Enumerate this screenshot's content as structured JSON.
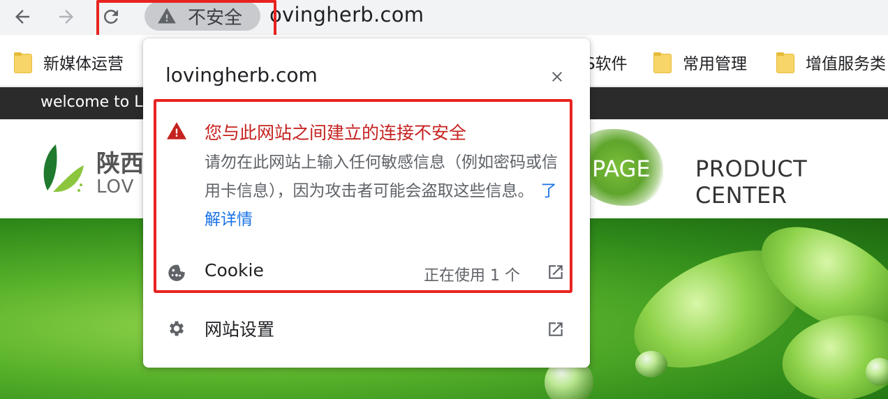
{
  "browser": {
    "back_icon": "arrow-left-icon",
    "forward_icon": "arrow-right-icon",
    "reload_icon": "reload-icon",
    "security_chip": {
      "icon": "warning-triangle-icon",
      "label": "不安全"
    },
    "url_visible": "ovingherb.com"
  },
  "bookmarks": [
    {
      "label": "新媒体运营",
      "icon": "folder-icon"
    },
    {
      "label": "S软件",
      "icon": "folder-icon"
    },
    {
      "label": "常用管理",
      "icon": "folder-icon"
    },
    {
      "label": "增值服务类",
      "icon": "folder-icon"
    }
  ],
  "site": {
    "welcome_text": "welcome to L",
    "logo_cn": "陕西",
    "logo_en": "LOV",
    "nav_home": "PAGE",
    "nav_product": "PRODUCT CENTER"
  },
  "popup": {
    "title": "lovingherb.com",
    "close_icon": "close-icon",
    "warning": {
      "icon": "warning-triangle-icon",
      "title": "您与此网站之间建立的连接不安全",
      "body": "请勿在此网站上输入任何敏感信息（例如密码或信用卡信息），因为攻击者可能会盗取这些信息。",
      "link": "了解详情"
    },
    "cookie": {
      "icon": "cookie-icon",
      "label": "Cookie",
      "count": "正在使用 1 个",
      "open_icon": "external-link-icon"
    },
    "settings": {
      "icon": "gear-icon",
      "label": "网站设置",
      "open_icon": "external-link-icon"
    }
  },
  "colors": {
    "highlight": "#e8231f",
    "warning_red": "#c5221f",
    "link_blue": "#1a73e8",
    "chip_bg": "#c8cacd"
  }
}
